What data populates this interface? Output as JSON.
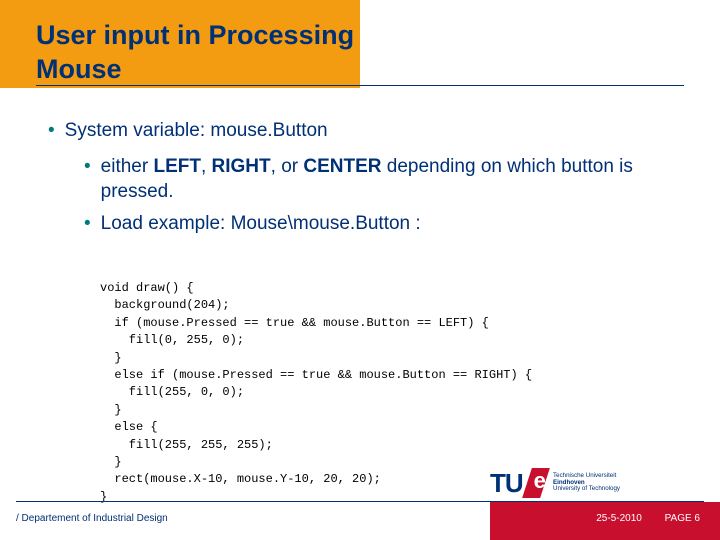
{
  "title_line1": "User input in Processing",
  "title_line2": "Mouse",
  "bullets": {
    "main": "System variable: mouse.Button",
    "sub1_prefix": "either ",
    "sub1_left": "LEFT",
    "sub1_sep1": ", ",
    "sub1_right": "RIGHT",
    "sub1_sep2": ", or ",
    "sub1_center": "CENTER",
    "sub1_suffix": " depending on which button is pressed.",
    "sub2": "Load example: Mouse\\mouse.Button :"
  },
  "code": "void draw() {\n  background(204);\n  if (mouse.Pressed == true && mouse.Button == LEFT) {\n    fill(0, 255, 0);\n  }\n  else if (mouse.Pressed == true && mouse.Button == RIGHT) {\n    fill(255, 0, 0);\n  }\n  else {\n    fill(255, 255, 255);\n  }\n  rect(mouse.X-10, mouse.Y-10, 20, 20);\n}",
  "footer": {
    "dept": "/ Departement of Industrial Design",
    "date": "25-5-2010",
    "page": "PAGE 6"
  },
  "logo": {
    "tu": "TU",
    "e": "e",
    "sub1": "Technische Universiteit",
    "sub2": "Eindhoven",
    "sub3": "University of Technology"
  }
}
